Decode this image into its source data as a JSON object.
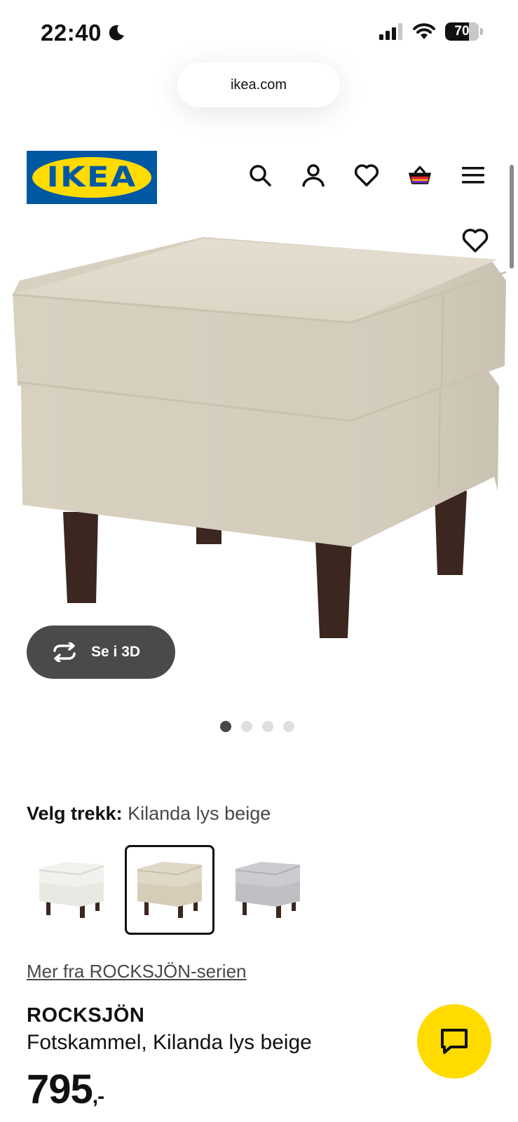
{
  "status_bar": {
    "time": "22:40",
    "battery": "70"
  },
  "browser": {
    "url": "ikea.com"
  },
  "header": {
    "logo_text": "IKEA"
  },
  "product_image": {
    "see_3d_label": "Se i 3D",
    "carousel_total": 4,
    "carousel_active": 1
  },
  "variant": {
    "label": "Velg trekk:",
    "selected_value": "Kilanda lys beige",
    "options": [
      {
        "color": "#eeeeea"
      },
      {
        "color": "#d9cfb7"
      },
      {
        "color": "#c2c3c5"
      }
    ]
  },
  "series_link": "Mer fra ROCKSJÖN-serien",
  "product": {
    "name": "ROCKSJÖN",
    "description": "Fotskammel, Kilanda lys beige",
    "price": "795",
    "price_suffix": ",-"
  },
  "colors": {
    "brand_blue": "#0058a3",
    "brand_yellow": "#ffdb00",
    "fabric": "#ddd6c5",
    "legs": "#3b2620"
  }
}
